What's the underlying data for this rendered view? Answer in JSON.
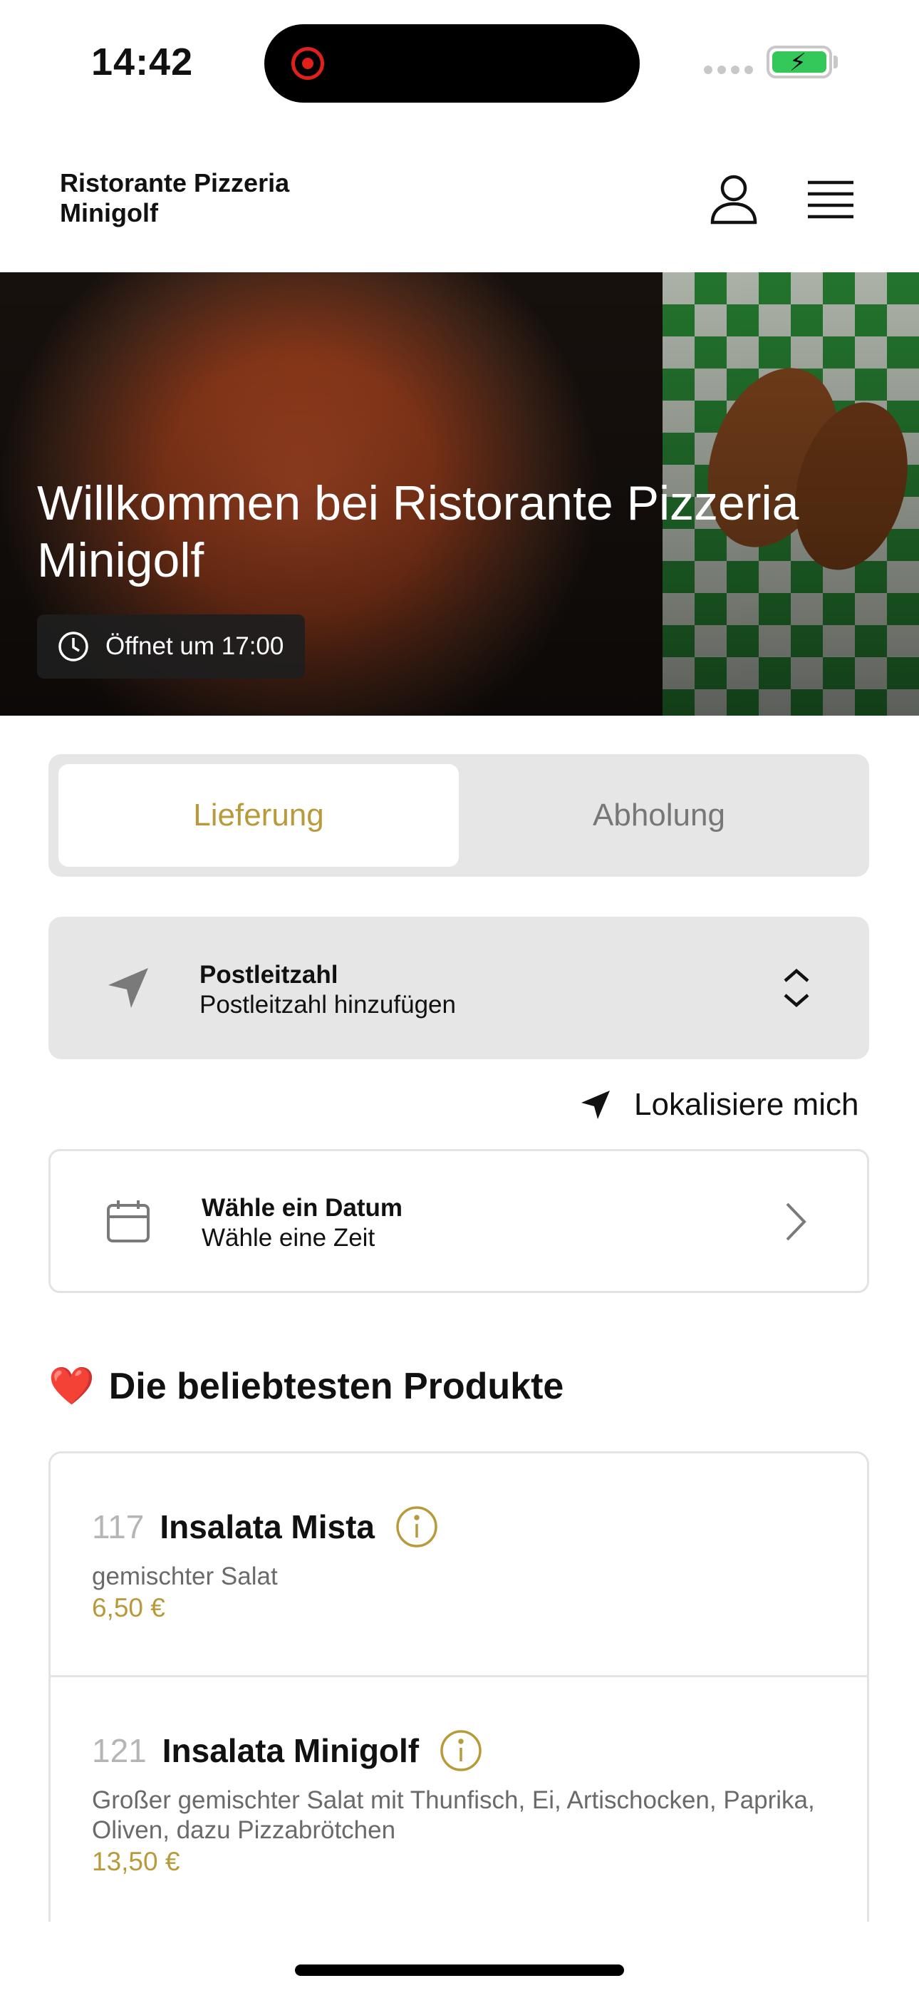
{
  "status_bar": {
    "time": "14:42"
  },
  "header": {
    "brand": "Ristorante Pizzeria Minigolf",
    "profile_icon": "user-icon",
    "menu_icon": "hamburger-menu-icon"
  },
  "hero": {
    "title": "Willkommen bei Ristorante Pizzeria Minigolf",
    "hours": "Öffnet um 17:00"
  },
  "order_mode": {
    "tabs": [
      {
        "label": "Lieferung",
        "active": true
      },
      {
        "label": "Abholung",
        "active": false
      }
    ]
  },
  "postal": {
    "title": "Postleitzahl",
    "placeholder": "Postleitzahl hinzufügen"
  },
  "locate": {
    "label": "Lokalisiere mich"
  },
  "schedule": {
    "title": "Wähle ein Datum",
    "subtitle": "Wähle eine Zeit"
  },
  "popular": {
    "heading": "Die beliebtesten Produkte",
    "products": [
      {
        "number": "117",
        "name": "Insalata Mista",
        "description": "gemischter Salat",
        "price": "6,50 €"
      },
      {
        "number": "121",
        "name": "Insalata Minigolf",
        "description": "Großer gemischter Salat mit Thunfisch, Ei, Artischocken, Paprika, Oliven, dazu Pizzabrötchen",
        "price": "13,50 €"
      }
    ]
  },
  "colors": {
    "accent": "#b89a3a",
    "card_bg": "#e6e6e6",
    "border": "#e3e3e3"
  }
}
